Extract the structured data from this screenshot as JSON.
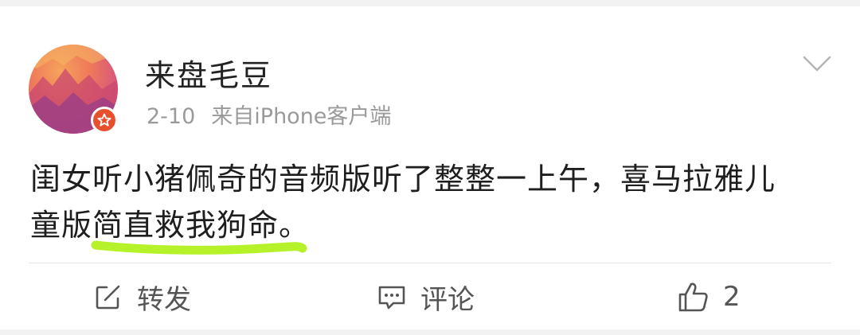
{
  "post": {
    "author": "来盘毛豆",
    "date": "2-10",
    "source": "来自iPhone客户端",
    "text_line1": "闺女听小猪佩奇的音频版听了整整一上午，喜马拉雅儿",
    "text_line2_prefix": "童版",
    "text_line2_highlight": "简直救我狗命",
    "text_line2_suffix": "。"
  },
  "actions": {
    "repost_label": "转发",
    "comment_label": "评论",
    "like_count": "2"
  },
  "colors": {
    "badge": "#e8502d",
    "highlight_mark": "#b6f22a",
    "text": "#1e1e1e",
    "meta": "#9a9a9a"
  },
  "icons": [
    "chevron-down-icon",
    "repost-icon",
    "comment-icon",
    "thumbs-up-icon",
    "verified-badge-icon"
  ]
}
